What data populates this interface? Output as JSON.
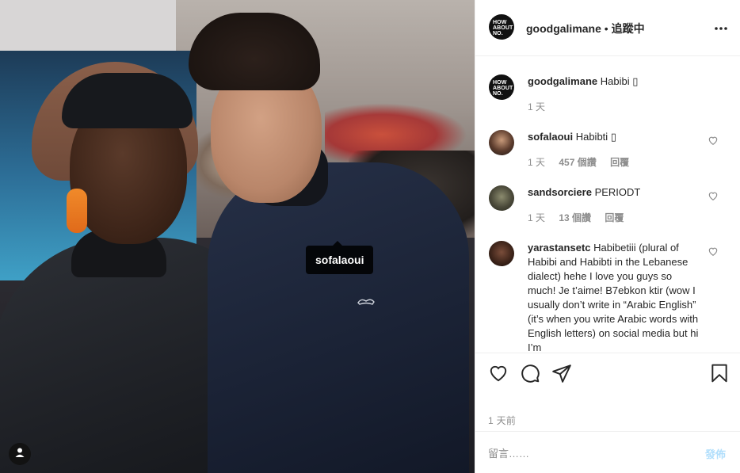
{
  "post": {
    "author": "goodgalimane",
    "separator": "•",
    "follow_status": "追蹤中",
    "avatar_logo_text": [
      "HOW",
      "ABOUT",
      "NO."
    ],
    "photo_tag": "sofalaoui",
    "brand_color": "#0095f6"
  },
  "caption": {
    "user": "goodgalimane",
    "text": "Habibi ",
    "time": "1 天"
  },
  "comments": [
    {
      "user": "sofalaoui",
      "text": "Habibti ",
      "time": "1 天",
      "likes": "457 個讚",
      "reply": "回覆"
    },
    {
      "user": "sandsorciere",
      "text": "PERIODT",
      "time": "1 天",
      "likes": "13 個讚",
      "reply": "回覆"
    },
    {
      "user": "yarastansetc",
      "text": "Habibetiii (plural of Habibi and Habibti in the Lebanese dialect) hehe I love you guys so much! Je t’aime! B7ebkon ktir (wow I usually don’t write in “Arabic English” (it’s when you write Arabic words with English letters) on social media but hi I’m"
    }
  ],
  "actions": {
    "icons": [
      "heart-icon",
      "comment-icon",
      "share-icon",
      "bookmark-icon"
    ],
    "timestamp": "1 天前"
  },
  "add_comment": {
    "placeholder": "留言……",
    "post_label": "發佈"
  }
}
